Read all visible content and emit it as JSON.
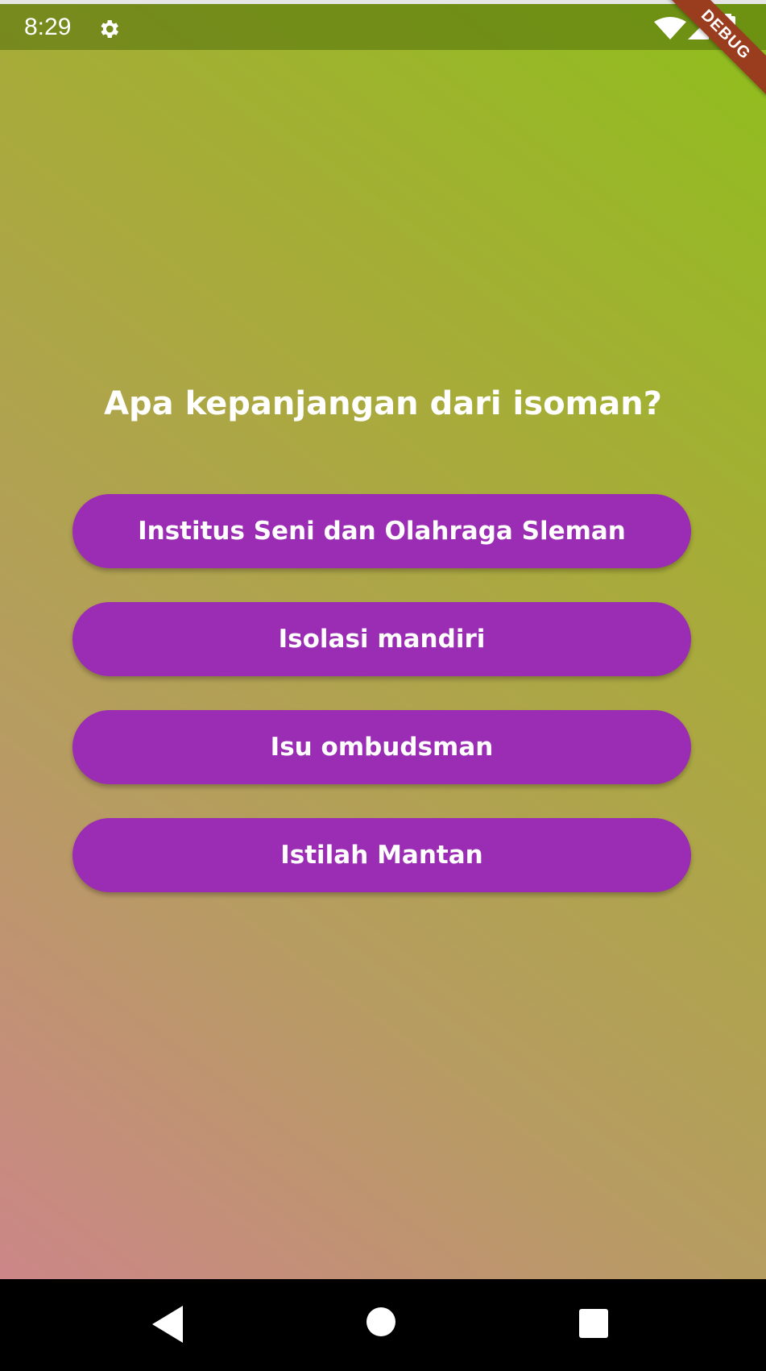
{
  "status_bar": {
    "time": "8:29",
    "icons": [
      "gear-icon",
      "wifi-icon",
      "signal-icon",
      "battery-icon"
    ]
  },
  "debug_banner": "DEBUG",
  "quiz": {
    "question": "Apa kepanjangan dari isoman?",
    "answers": [
      "Institus Seni dan Olahraga Sleman",
      "Isolasi mandiri",
      "Isu  ombudsman",
      "Istilah Mantan"
    ]
  },
  "nav_bar": {
    "icons": [
      "back-icon",
      "home-icon",
      "recents-icon"
    ]
  },
  "colors": {
    "button": "#9b2cb4",
    "gradient_top_right": "#8fbf1c",
    "gradient_bottom_left": "#cc8688",
    "debug_ribbon": "#9a3c1e"
  }
}
